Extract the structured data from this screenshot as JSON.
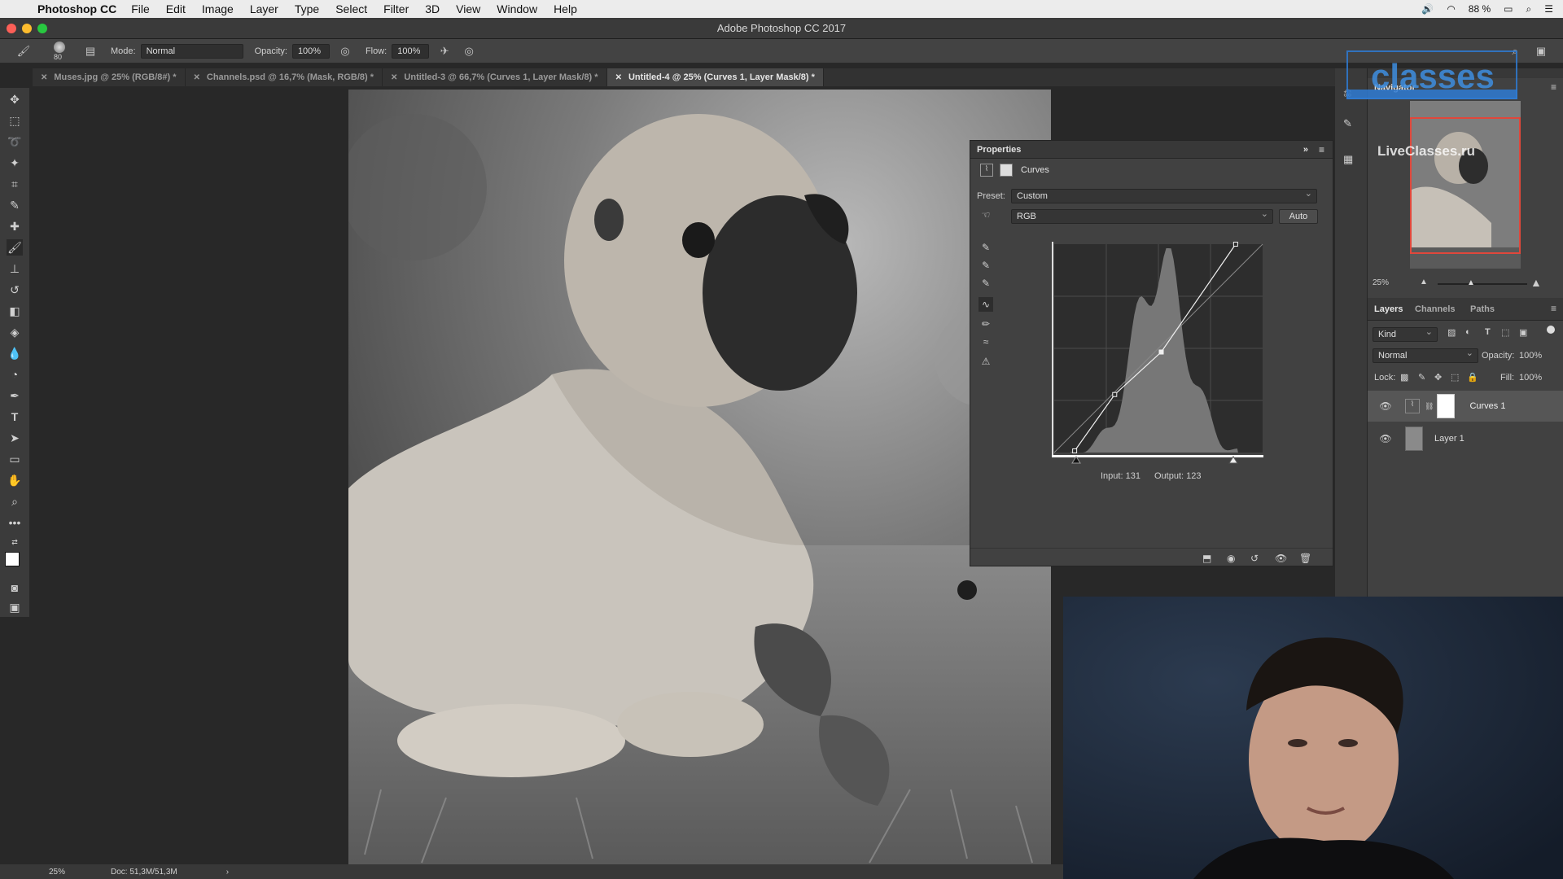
{
  "menubar": {
    "app_name": "Photoshop CC",
    "items": [
      "File",
      "Edit",
      "Image",
      "Layer",
      "Type",
      "Select",
      "Filter",
      "3D",
      "View",
      "Window",
      "Help"
    ],
    "battery": "88 %"
  },
  "window": {
    "title": "Adobe Photoshop CC 2017"
  },
  "options": {
    "brush_size": "80",
    "mode_label": "Mode:",
    "mode_value": "Normal",
    "opacity_label": "Opacity:",
    "opacity_value": "100%",
    "flow_label": "Flow:",
    "flow_value": "100%"
  },
  "tabs": [
    {
      "label": "Muses.jpg @ 25% (RGB/8#) *",
      "active": false
    },
    {
      "label": "Channels.psd @ 16,7% (Mask, RGB/8) *",
      "active": false
    },
    {
      "label": "Untitled-3 @ 66,7% (Curves 1, Layer Mask/8) *",
      "active": false
    },
    {
      "label": "Untitled-4 @ 25% (Curves 1, Layer Mask/8) *",
      "active": true
    }
  ],
  "status": {
    "zoom": "25%",
    "doc": "Doc: 51,3M/51,3M"
  },
  "properties": {
    "title": "Properties",
    "adjustment": "Curves",
    "preset_label": "Preset:",
    "preset_value": "Custom",
    "channel": "RGB",
    "auto_label": "Auto",
    "input_readout": "Input: 131",
    "output_readout": "Output: 123",
    "curve_points": [
      {
        "input": 25,
        "output": 2
      },
      {
        "input": 74,
        "output": 71
      },
      {
        "input": 131,
        "output": 123
      },
      {
        "input": 222,
        "output": 255
      }
    ]
  },
  "navigator": {
    "title": "Navigator",
    "zoom": "25%"
  },
  "layers_panel": {
    "tabs": [
      "Layers",
      "Channels",
      "Paths"
    ],
    "kind_label": "Kind",
    "blend_mode": "Normal",
    "opacity_label": "Opacity:",
    "opacity_value": "100%",
    "lock_label": "Lock:",
    "fill_label": "Fill:",
    "fill_value": "100%",
    "layers": [
      {
        "name": "Curves 1",
        "visible": true,
        "selected": true
      },
      {
        "name": "Layer 1",
        "visible": true,
        "selected": false
      }
    ]
  },
  "watermark": {
    "brand": "classes",
    "site": "LiveClasses.ru"
  }
}
